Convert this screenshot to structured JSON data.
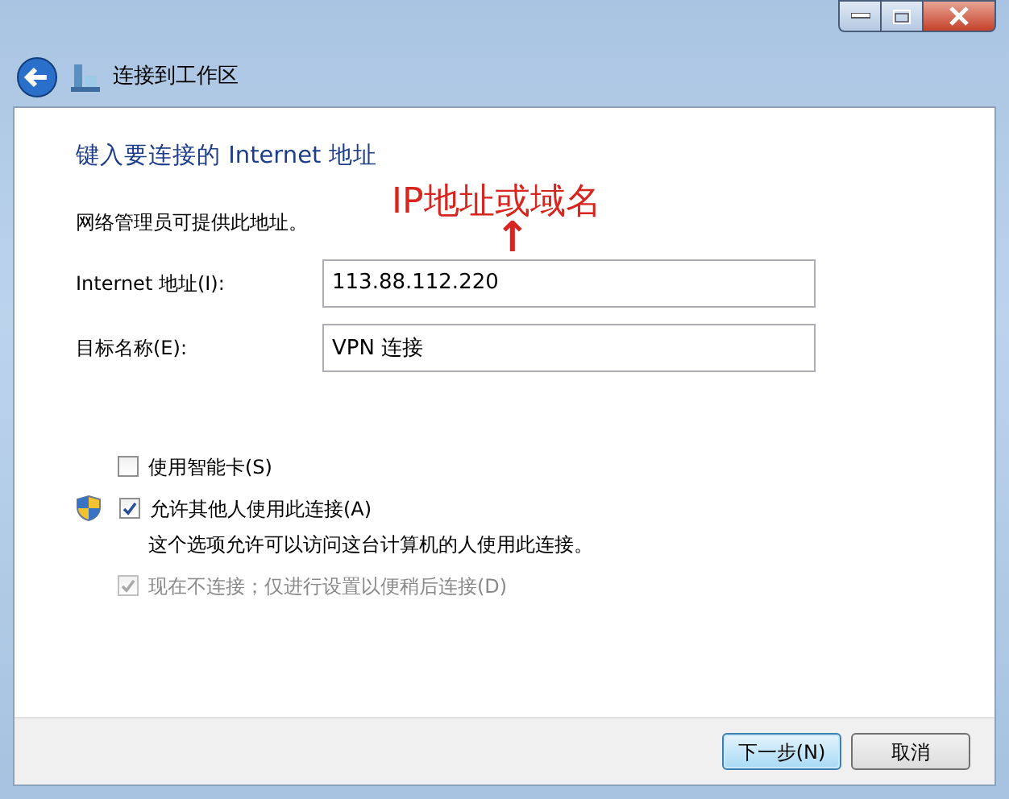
{
  "window": {
    "title": "连接到工作区"
  },
  "heading": "键入要连接的 Internet 地址",
  "intro": "网络管理员可提供此地址。",
  "annotation": {
    "text": "IP地址或域名",
    "arrow": "↑"
  },
  "fields": [
    {
      "label": "Internet 地址(I):",
      "value": "113.88.112.220"
    },
    {
      "label": "目标名称(E):",
      "value": "VPN 连接"
    }
  ],
  "options": [
    {
      "label": "使用智能卡(S)",
      "checked": false,
      "disabled": false,
      "shield": false
    },
    {
      "label": "允许其他人使用此连接(A)",
      "checked": true,
      "disabled": false,
      "shield": true,
      "note": "这个选项允许可以访问这台计算机的人使用此连接。"
    },
    {
      "label": "现在不连接；仅进行设置以便稍后连接(D)",
      "checked": true,
      "disabled": true,
      "shield": false
    }
  ],
  "buttons": [
    {
      "label": "下一步(N)",
      "kind": "default"
    },
    {
      "label": "取消",
      "kind": "normal"
    }
  ]
}
